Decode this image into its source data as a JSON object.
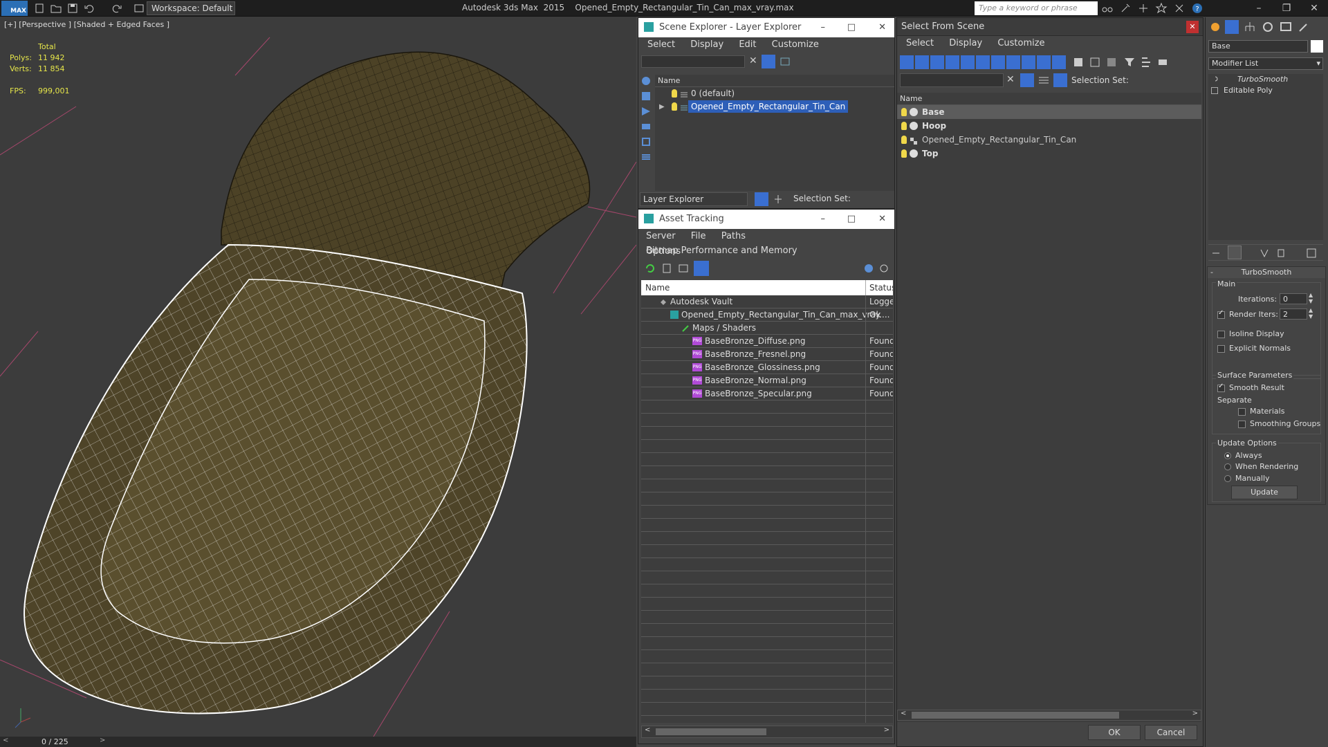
{
  "app": {
    "logo": "MAX",
    "workspace": "Workspace: Default",
    "title": "Autodesk 3ds Max  2015    Opened_Empty_Rectangular_Tin_Can_max_vray.max",
    "search_placeholder": "Type a keyword or phrase"
  },
  "viewport": {
    "label": "[+] [Perspective ] [Shaded + Edged Faces ]",
    "stats_header": "Total",
    "polys_label": "Polys:",
    "polys_value": "11 942",
    "verts_label": "Verts:",
    "verts_value": "11 854",
    "fps_label": "FPS:",
    "fps_value": "999,001",
    "timeline": "0 / 225"
  },
  "scene_explorer": {
    "title": "Scene Explorer - Layer Explorer",
    "menu": [
      "Select",
      "Display",
      "Edit",
      "Customize"
    ],
    "col_name": "Name",
    "rows": [
      "0 (default)",
      "Opened_Empty_Rectangular_Tin_Can"
    ],
    "footer_mode": "Layer Explorer",
    "selection_set": "Selection Set:"
  },
  "asset_tracking": {
    "title": "Asset Tracking",
    "menu": [
      "Server",
      "File",
      "Paths",
      "Bitmap Performance and Memory"
    ],
    "menu2": "Options",
    "col_name": "Name",
    "col_status": "Status",
    "rows": [
      {
        "name": "Autodesk Vault",
        "status": "Logged"
      },
      {
        "name": "Opened_Empty_Rectangular_Tin_Can_max_vray....",
        "status": "Ok"
      },
      {
        "name": "Maps / Shaders",
        "status": ""
      },
      {
        "name": "BaseBronze_Diffuse.png",
        "status": "Found"
      },
      {
        "name": "BaseBronze_Fresnel.png",
        "status": "Found"
      },
      {
        "name": "BaseBronze_Glossiness.png",
        "status": "Found"
      },
      {
        "name": "BaseBronze_Normal.png",
        "status": "Found"
      },
      {
        "name": "BaseBronze_Specular.png",
        "status": "Found"
      }
    ]
  },
  "select_from_scene": {
    "title": "Select From Scene",
    "menu": [
      "Select",
      "Display",
      "Customize"
    ],
    "selection_set": "Selection Set:",
    "col_name": "Name",
    "rows": [
      "Base",
      "Hoop",
      "Opened_Empty_Rectangular_Tin_Can",
      "Top"
    ],
    "ok": "OK",
    "cancel": "Cancel"
  },
  "modify_panel": {
    "object_name": "Base",
    "modifier_list": "Modifier List",
    "stack": [
      "TurboSmooth",
      "Editable Poly"
    ],
    "rollout_title": "TurboSmooth",
    "main_label": "Main",
    "iterations_label": "Iterations:",
    "iterations_value": "0",
    "render_iters_label": "Render Iters:",
    "render_iters_value": "2",
    "isoline": "Isoline Display",
    "explicit_normals": "Explicit Normals",
    "surface_params": "Surface Parameters",
    "smooth_result": "Smooth Result",
    "separate": "Separate",
    "materials": "Materials",
    "smoothing_groups": "Smoothing Groups",
    "update_options": "Update Options",
    "always": "Always",
    "when_rendering": "When Rendering",
    "manually": "Manually",
    "update_button": "Update"
  },
  "colors": {
    "accent": "#3a6fd1",
    "selection": "#2e5fb8",
    "stats": "#e6e64a"
  }
}
